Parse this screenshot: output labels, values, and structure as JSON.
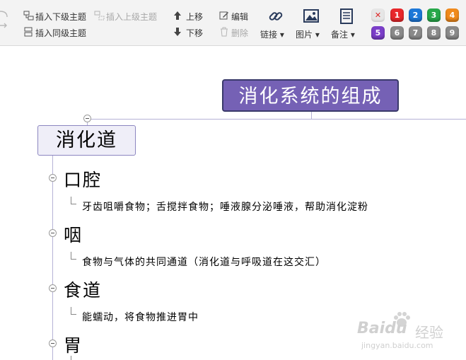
{
  "toolbar": {
    "insert_child": "插入下级主题",
    "insert_parent": "插入上级主题",
    "insert_sibling": "插入同级主题",
    "move_up": "上移",
    "move_down": "下移",
    "edit": "编辑",
    "delete": "删除",
    "link": "链接",
    "image": "图片",
    "note": "备注",
    "priorities": [
      "1",
      "2",
      "3",
      "4",
      "5",
      "6",
      "7",
      "8",
      "9"
    ],
    "priority_colors": {
      "clear": "#e6e6e6",
      "1": "#e8272b",
      "2": "#1d78d8",
      "3": "#27a84a",
      "4": "#f08a1c",
      "5": "#7b3ec9",
      "6": "#8a8a8a",
      "7": "#8a8a8a",
      "8": "#8a8a8a",
      "9": "#8a8a8a"
    }
  },
  "mindmap": {
    "central": "消化系统的组成",
    "main_topic": "消化道",
    "subtopics": [
      {
        "title": "口腔",
        "detail": "牙齿咀嚼食物；舌搅拌食物；唾液腺分泌唾液，帮助消化淀粉"
      },
      {
        "title": "咽",
        "detail": "食物与气体的共同通道（消化道与呼吸道在这交汇）"
      },
      {
        "title": "食道",
        "detail": "能蠕动，将食物推进胃中"
      },
      {
        "title": "胃",
        "detail": ""
      }
    ],
    "central_color": "#7561b5"
  },
  "watermark": {
    "brand": "Baidu",
    "brand_cn": "经验",
    "url": "jingyan.baidu.com"
  }
}
